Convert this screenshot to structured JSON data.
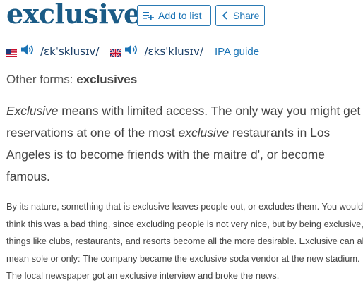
{
  "word": "exclusive",
  "buttons": {
    "add_to_list": "Add to list",
    "share": "Share"
  },
  "pronunciation": {
    "us": {
      "flag": "us-flag-icon",
      "ipa": "/ɛkˈsklusɪv/"
    },
    "uk": {
      "flag": "uk-flag-icon",
      "ipa": "/ɛksˈklusɪv/"
    },
    "guide_label": "IPA guide"
  },
  "other_forms": {
    "label": "Other forms:",
    "value": "exclusives"
  },
  "short_def": {
    "lead": "Exclusive",
    "part1": " means with limited access. The only way you might get reservations at one of the most ",
    "em2": "exclusive",
    "part2": " restaurants in Los Angeles is to become friends with the maitre d', or become famous."
  },
  "long_def": "By its nature, something that is exclusive leaves people out, or excludes them. You would think this was a bad thing, since excluding people is not very nice, but by being exclusive, things like clubs, restaurants, and resorts become all the more desirable. Exclusive can also mean sole or only: The company became the exclusive soda vendor at the new stadium. The local newspaper got an exclusive interview and broke the news.",
  "colors": {
    "title": "#1a5b86",
    "accent": "#1a73b5",
    "text": "#444444"
  }
}
